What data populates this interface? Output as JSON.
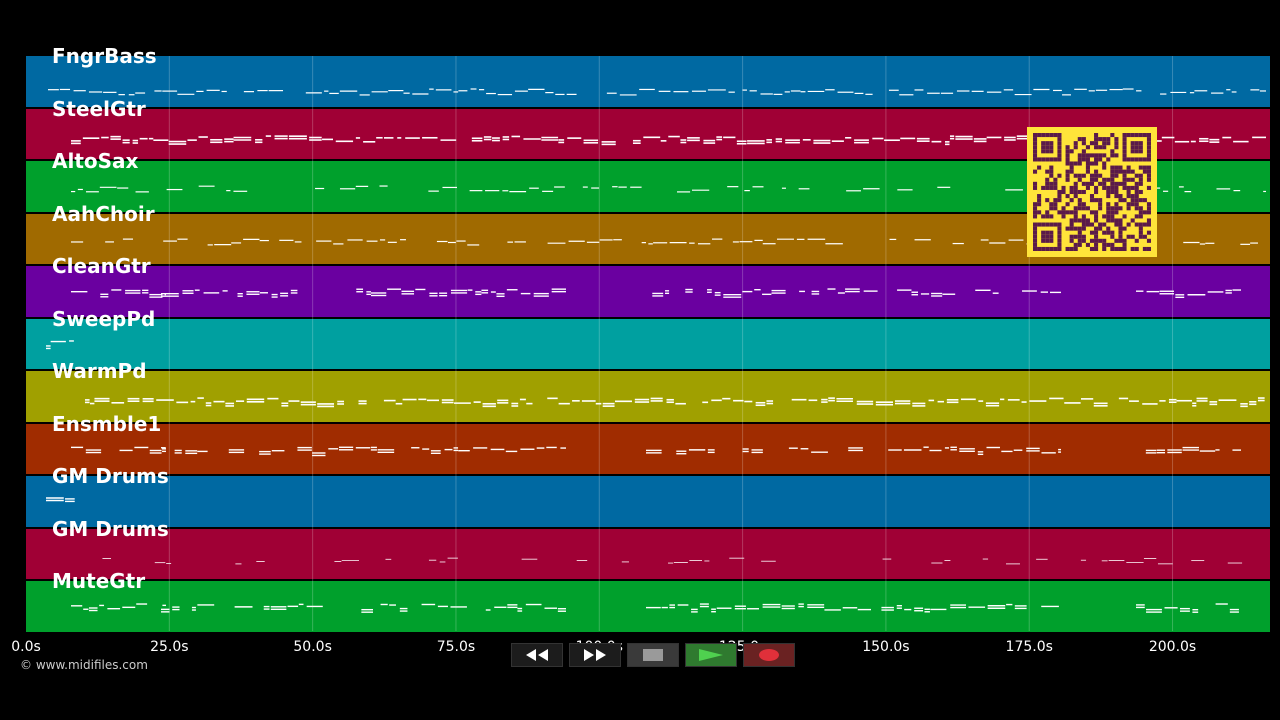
{
  "tracks": [
    {
      "name": "FngrBass",
      "color": "#0069a2",
      "pattern": "bass"
    },
    {
      "name": "SteelGtr",
      "color": "#a00035",
      "pattern": "dense"
    },
    {
      "name": "AltoSax",
      "color": "#00a02c",
      "pattern": "sparse"
    },
    {
      "name": "AahChoir",
      "color": "#a06a00",
      "pattern": "sparse"
    },
    {
      "name": "CleanGtr",
      "color": "#6a00a0",
      "pattern": "sections"
    },
    {
      "name": "SweepPd",
      "color": "#00a0a0",
      "pattern": "start"
    },
    {
      "name": "WarmPd",
      "color": "#a0a000",
      "pattern": "dense"
    },
    {
      "name": "Ensmble1",
      "color": "#a02c00",
      "pattern": "sections"
    },
    {
      "name": "GM Drums",
      "color": "#0069a2",
      "pattern": "start"
    },
    {
      "name": "GM Drums",
      "color": "#a00035",
      "pattern": "dots"
    },
    {
      "name": "MuteGtr",
      "color": "#00a02c",
      "pattern": "sections"
    }
  ],
  "timeline": {
    "max_seconds": 217,
    "ticks": [
      {
        "value": 0,
        "label": "0.0s"
      },
      {
        "value": 25,
        "label": "25.0s"
      },
      {
        "value": 50,
        "label": "50.0s"
      },
      {
        "value": 75,
        "label": "75.0s"
      },
      {
        "value": 100,
        "label": "100.0s"
      },
      {
        "value": 125,
        "label": "125.0s"
      },
      {
        "value": 150,
        "label": "150.0s"
      },
      {
        "value": 175,
        "label": "175.0s"
      },
      {
        "value": 200,
        "label": "200.0s"
      }
    ]
  },
  "copyright": "© www.midifiles.com",
  "transport": {
    "rewind_icon": "rewind-icon",
    "fast_forward_icon": "fast-forward-icon",
    "stop_icon": "stop-icon",
    "play_icon": "play-icon",
    "record_icon": "record-icon"
  },
  "colors": {
    "qr_background": "#ffe43a",
    "qr_foreground": "#5a1a4a",
    "note": "#ffffff"
  }
}
